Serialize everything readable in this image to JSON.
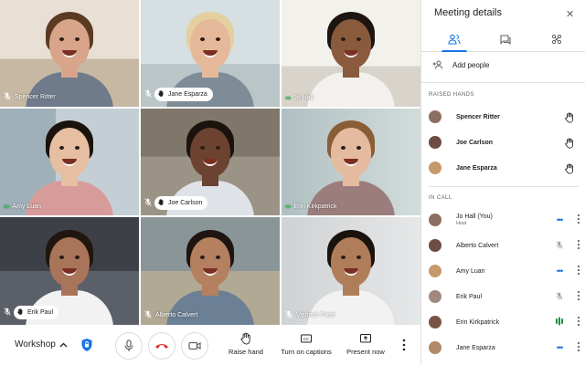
{
  "meeting": {
    "name": "Workshop"
  },
  "tiles": [
    {
      "name": "Spencer Ritter",
      "status": "muted",
      "bg": "#d9cfc2",
      "skin": "#d8a48a",
      "hair": "#5a3b22",
      "shirt": "#6f7b8a"
    },
    {
      "name": "Jane Esparza",
      "status": "hand",
      "bg": "#c9d3d6",
      "skin": "#e6b89a",
      "hair": "#e4cfa0",
      "shirt": "#7e8c97"
    },
    {
      "name": "Jo Hall",
      "status": "speaking",
      "bg": "#eceae6",
      "skin": "#8a5a3c",
      "hair": "#1e1510",
      "shirt": "#f3f1ee"
    },
    {
      "name": "Amy Luan",
      "status": "speaking",
      "bg": "#b8c5cb",
      "skin": "#e6bea1",
      "hair": "#1a120d",
      "shirt": "#d79c9a"
    },
    {
      "name": "Joe Carlson",
      "status": "hand",
      "bg": "#8b8477",
      "skin": "#6b4330",
      "hair": "#1a120d",
      "shirt": "#dfe3e8"
    },
    {
      "name": "Erin Kirkpatrick",
      "status": "speaking",
      "bg": "#b7c6c7",
      "skin": "#e4bba0",
      "hair": "#8a5d36",
      "shirt": "#9a7d7c"
    },
    {
      "name": "Erik Paul",
      "status": "hand",
      "bg": "#4d5157",
      "skin": "#a8745a",
      "hair": "#20160f",
      "shirt": "#f2f2f2"
    },
    {
      "name": "Alberto Calvert",
      "status": "muted",
      "bg": "#9aa3a5",
      "skin": "#b48060",
      "hair": "#1e1510",
      "shirt": "#6b8095"
    },
    {
      "name": "Vishesh Patel",
      "status": "muted",
      "bg": "#d7d9db",
      "skin": "#b07d5a",
      "hair": "#1a120d",
      "shirt": "#f2f2f2"
    }
  ],
  "controls": {
    "raise_hand": "Raise hand",
    "captions": "Turn on captions",
    "present": "Present now",
    "end_call_color": "#d93025"
  },
  "panel": {
    "title": "Meeting details",
    "add_people": "Add people",
    "raised_hands_label": "RAISED HANDS",
    "in_call_label": "IN CALL",
    "raised_hands": [
      {
        "name": "Spencer Ritter"
      },
      {
        "name": "Joe Carlson"
      },
      {
        "name": "Jane Esparza"
      }
    ],
    "in_call": [
      {
        "name": "Jo Hall (You)",
        "sub": "Host",
        "status": "speaking"
      },
      {
        "name": "Alberto Calvert",
        "sub": "",
        "status": "muted"
      },
      {
        "name": "Amy Luan",
        "sub": "",
        "status": "speaking"
      },
      {
        "name": "Erik Paul",
        "sub": "",
        "status": "muted"
      },
      {
        "name": "Erin Kirkpatrick",
        "sub": "",
        "status": "talking"
      },
      {
        "name": "Jane Esparza",
        "sub": "",
        "status": "speaking"
      }
    ]
  },
  "colors": {
    "accent": "#1a73e8",
    "talking": "#1e8e3e",
    "speaking_dots": "#34c759"
  }
}
